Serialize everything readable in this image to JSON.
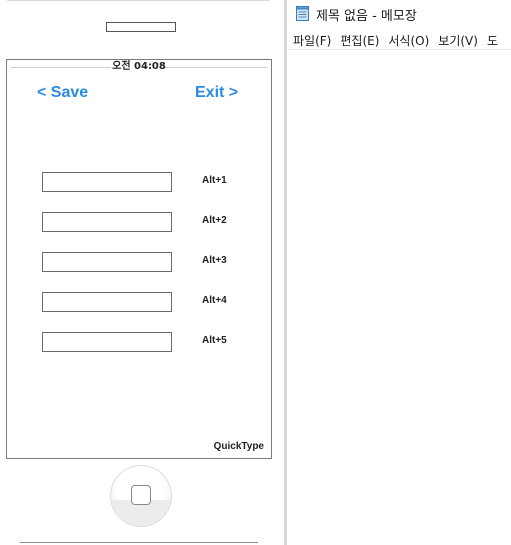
{
  "phone": {
    "status_time": "오전 04:08",
    "save_label": "< Save",
    "exit_label": "Exit >",
    "rows": [
      {
        "value": "",
        "hint": "Alt+1"
      },
      {
        "value": "",
        "hint": "Alt+2"
      },
      {
        "value": "",
        "hint": "Alt+3"
      },
      {
        "value": "",
        "hint": "Alt+4"
      },
      {
        "value": "",
        "hint": "Alt+5"
      }
    ],
    "brand": "QuickType",
    "accent_color": "#2a8be0"
  },
  "notepad": {
    "title": "제목 없음 - 메모장",
    "menu": [
      "파일(F)",
      "편집(E)",
      "서식(O)",
      "보기(V)",
      "도"
    ]
  }
}
